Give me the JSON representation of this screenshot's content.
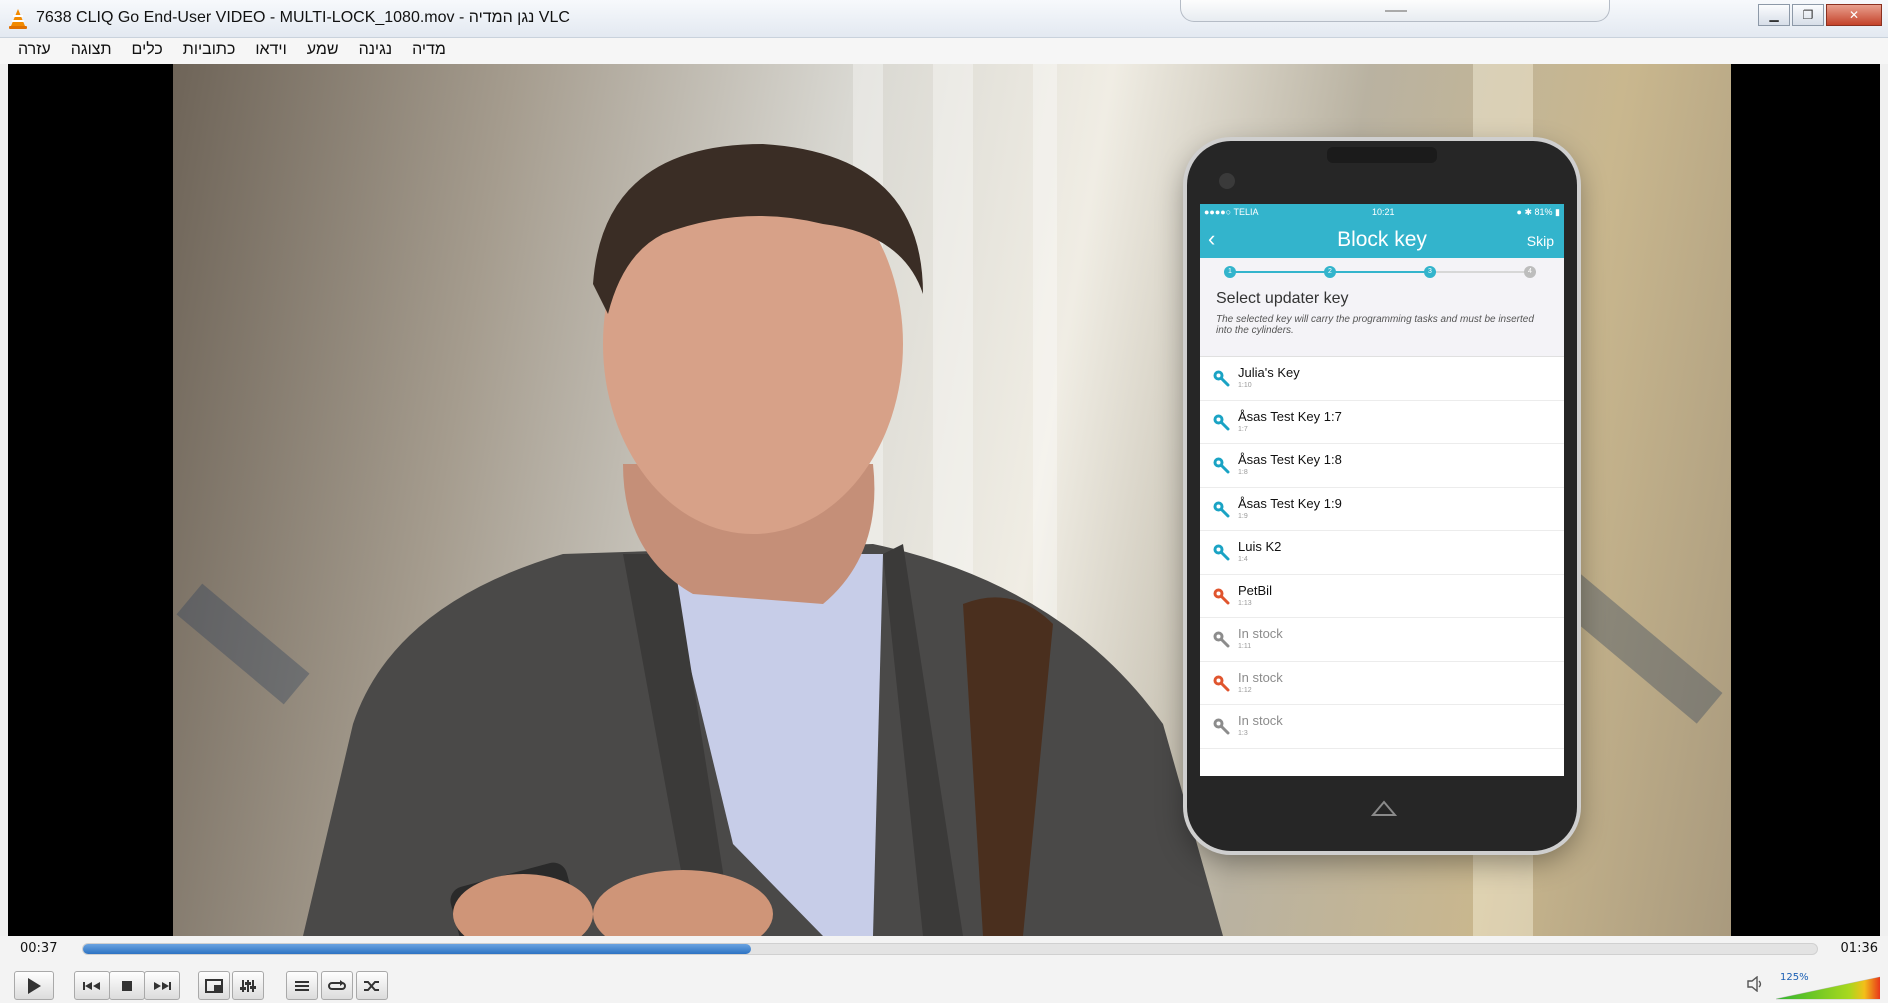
{
  "window": {
    "title": "7638 CLIQ Go End-User VIDEO - MULTI-LOCK_1080.mov - נגן המדיה VLC"
  },
  "menu": {
    "items": [
      "מדיה",
      "נגינה",
      "שמע",
      "וידאו",
      "כתוביות",
      "כלים",
      "תצוגה",
      "עזרה"
    ]
  },
  "video_overlay": {
    "status": {
      "carrier": "●●●●○ TELIA ",
      "time": "10:21",
      "battery": "● ✱ 81% ▮"
    },
    "title": "Block key",
    "skip": "Skip",
    "steps": [
      "1",
      "2",
      "3",
      "4"
    ],
    "heading": "Select updater key",
    "subtitle": "The selected key will carry the programming tasks and must be inserted into the cylinders.",
    "keys": [
      {
        "name": "Julia's Key",
        "id": "1:10",
        "icon_color": "#1aa3c4"
      },
      {
        "name": "Åsas Test Key 1:7",
        "id": "1:7",
        "icon_color": "#1aa3c4"
      },
      {
        "name": "Åsas Test Key 1:8",
        "id": "1:8",
        "icon_color": "#1aa3c4"
      },
      {
        "name": "Åsas Test Key 1:9",
        "id": "1:9",
        "icon_color": "#1aa3c4"
      },
      {
        "name": "Luis K2",
        "id": "1:4",
        "icon_color": "#1aa3c4"
      },
      {
        "name": "PetBil",
        "id": "1:13",
        "icon_color": "#e0552e"
      },
      {
        "name": "In stock",
        "id": "1:11",
        "icon_color": "#8c8c8c"
      },
      {
        "name": "In stock",
        "id": "1:12",
        "icon_color": "#e0552e"
      },
      {
        "name": "In stock",
        "id": "1:3",
        "icon_color": "#8c8c8c"
      }
    ]
  },
  "player": {
    "elapsed": "00:37",
    "total": "01:36",
    "progress_fraction": 0.385,
    "volume_label": "125%",
    "buttons": [
      "play-icon",
      "previous-icon",
      "stop-icon",
      "next-icon",
      "fullscreen-icon",
      "extended-settings-icon",
      "playlist-icon",
      "loop-icon",
      "shuffle-icon"
    ]
  },
  "colors": {
    "accent": "#33b4cc",
    "seek_fill": "#2d73c3"
  }
}
